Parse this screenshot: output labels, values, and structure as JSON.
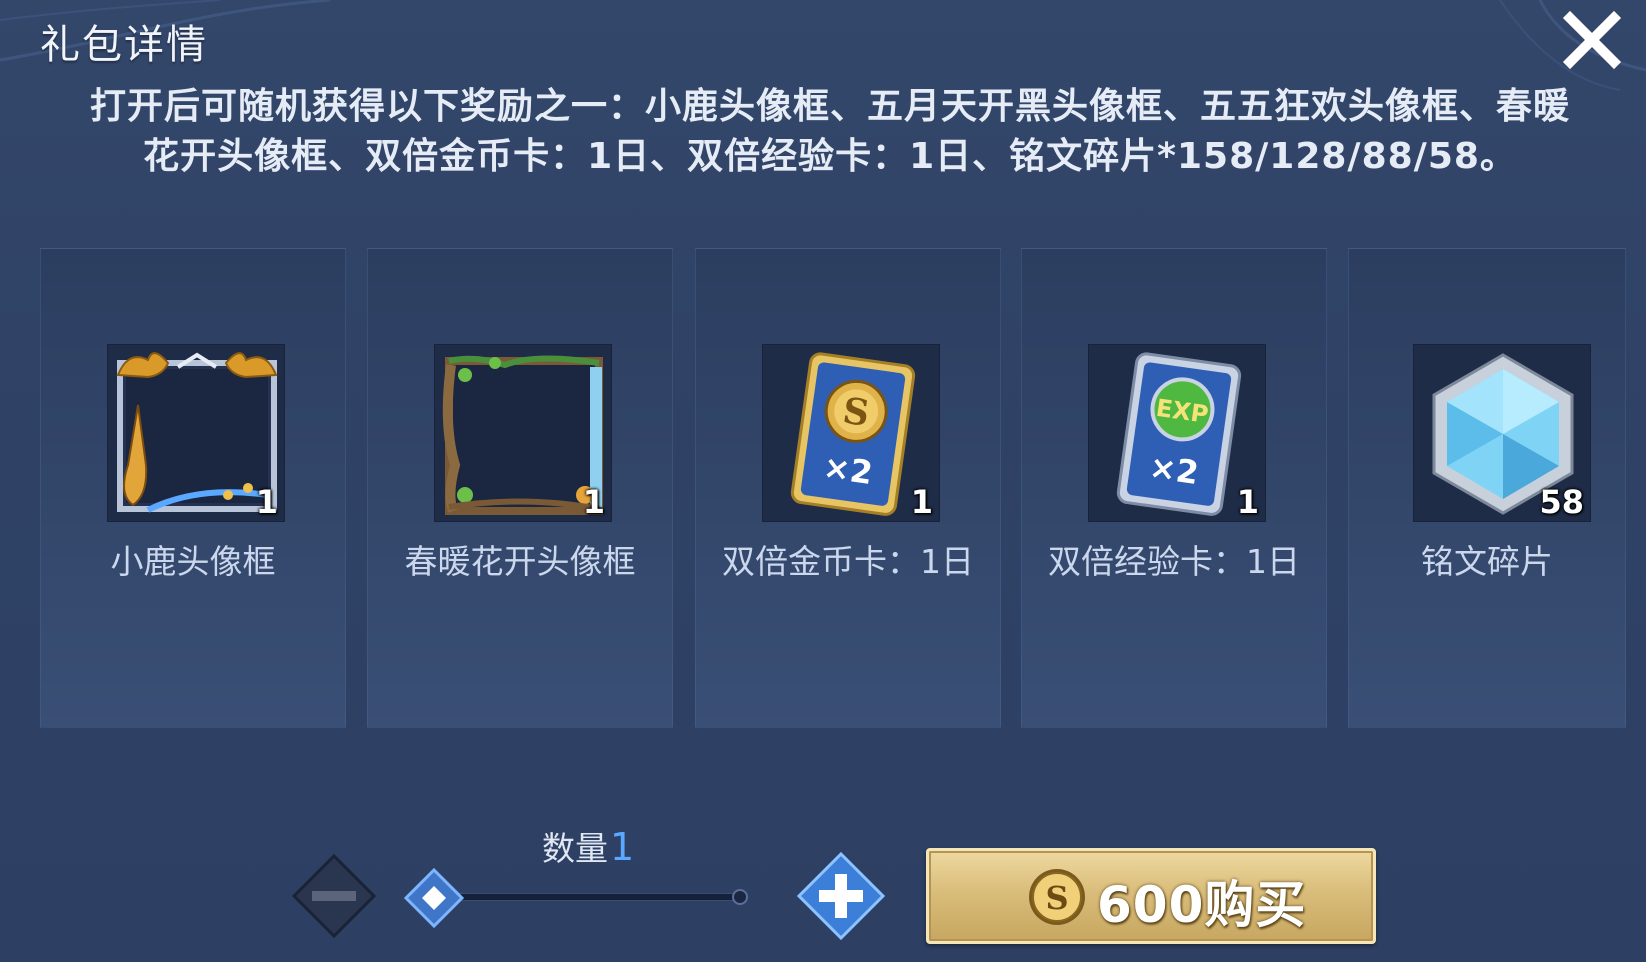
{
  "dialog": {
    "title": "礼包详情",
    "description": "打开后可随机获得以下奖励之一：小鹿头像框、五月天开黑头像框、五五狂欢头像框、春暖花开头像框、双倍金币卡：1日、双倍经验卡：1日、铭文碎片*158/128/88/58。"
  },
  "items": [
    {
      "name": "小鹿头像框",
      "count": "1",
      "icon": "deer-avatar-frame-icon"
    },
    {
      "name": "春暖花开头像框",
      "count": "1",
      "icon": "spring-flower-avatar-frame-icon"
    },
    {
      "name": "双倍金币卡：1日",
      "count": "1",
      "icon": "double-gold-card-icon",
      "badge": "×2"
    },
    {
      "name": "双倍经验卡：1日",
      "count": "1",
      "icon": "double-exp-card-icon",
      "badge": "×2",
      "badge_top": "EXP"
    },
    {
      "name": "铭文碎片",
      "count": "58",
      "icon": "inscription-shard-icon"
    }
  ],
  "quantity": {
    "label": "数量",
    "value": "1"
  },
  "buy": {
    "price": "600",
    "label": "600购买",
    "currency_icon": "gold-coin-icon"
  },
  "colors": {
    "accent": "#5aa8ff",
    "buy_gold": "#d9bd7a",
    "background": "#2f4266"
  }
}
